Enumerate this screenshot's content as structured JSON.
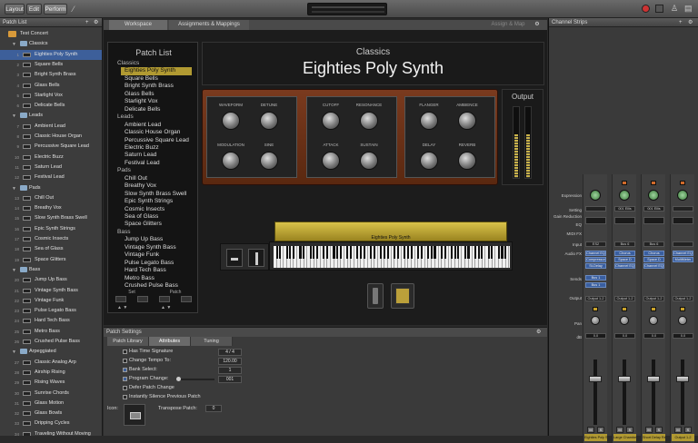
{
  "toolbar": {
    "layout": "Layout",
    "edit": "Edit",
    "perform": "Perform"
  },
  "patch_list_panel": {
    "title": "Patch List",
    "rows": [
      {
        "kind": "concert",
        "label": "Test Concert"
      },
      {
        "kind": "group",
        "label": "Classics"
      },
      {
        "kind": "patch",
        "num": "1",
        "label": "Eighties Poly Synth",
        "selected": true
      },
      {
        "kind": "patch",
        "num": "2",
        "label": "Square Bells"
      },
      {
        "kind": "patch",
        "num": "3",
        "label": "Bright Synth Brass"
      },
      {
        "kind": "patch",
        "num": "4",
        "label": "Glass Bells"
      },
      {
        "kind": "patch",
        "num": "5",
        "label": "Starlight Vox"
      },
      {
        "kind": "patch",
        "num": "6",
        "label": "Delicate Bells"
      },
      {
        "kind": "group",
        "label": "Leads"
      },
      {
        "kind": "patch",
        "num": "7",
        "label": "Ambient Lead"
      },
      {
        "kind": "patch",
        "num": "8",
        "label": "Classic House Organ"
      },
      {
        "kind": "patch",
        "num": "9",
        "label": "Percussive Square Lead"
      },
      {
        "kind": "patch",
        "num": "10",
        "label": "Electric Buzz"
      },
      {
        "kind": "patch",
        "num": "11",
        "label": "Saturn Lead"
      },
      {
        "kind": "patch",
        "num": "12",
        "label": "Festival Lead"
      },
      {
        "kind": "group",
        "label": "Pads"
      },
      {
        "kind": "patch",
        "num": "13",
        "label": "Chill Out"
      },
      {
        "kind": "patch",
        "num": "14",
        "label": "Breathy Vox"
      },
      {
        "kind": "patch",
        "num": "15",
        "label": "Slow Synth Brass Swell"
      },
      {
        "kind": "patch",
        "num": "16",
        "label": "Epic Synth Strings"
      },
      {
        "kind": "patch",
        "num": "17",
        "label": "Cosmic Insects"
      },
      {
        "kind": "patch",
        "num": "18",
        "label": "Sea of Glass"
      },
      {
        "kind": "patch",
        "num": "19",
        "label": "Space Glitters"
      },
      {
        "kind": "group",
        "label": "Bass"
      },
      {
        "kind": "patch",
        "num": "20",
        "label": "Jump Up Bass"
      },
      {
        "kind": "patch",
        "num": "21",
        "label": "Vintage Synth Bass"
      },
      {
        "kind": "patch",
        "num": "22",
        "label": "Vintage Funk"
      },
      {
        "kind": "patch",
        "num": "23",
        "label": "Pulse Legato Bass"
      },
      {
        "kind": "patch",
        "num": "24",
        "label": "Hard Tech Bass"
      },
      {
        "kind": "patch",
        "num": "25",
        "label": "Metro Bass"
      },
      {
        "kind": "patch",
        "num": "26",
        "label": "Crushed Pulse Bass"
      },
      {
        "kind": "group",
        "label": "Arpeggiated"
      },
      {
        "kind": "patch",
        "num": "27",
        "label": "Classic Analog Arp"
      },
      {
        "kind": "patch",
        "num": "28",
        "label": "Airship Rising"
      },
      {
        "kind": "patch",
        "num": "29",
        "label": "Rising Waves"
      },
      {
        "kind": "patch",
        "num": "30",
        "label": "Sunrise Chords"
      },
      {
        "kind": "patch",
        "num": "31",
        "label": "Glass Motion"
      },
      {
        "kind": "patch",
        "num": "32",
        "label": "Glass Bowls"
      },
      {
        "kind": "patch",
        "num": "33",
        "label": "Dripping Cycles"
      },
      {
        "kind": "patch",
        "num": "34",
        "label": "Traveling Without Moving"
      }
    ]
  },
  "tabs": {
    "workspace": "Workspace",
    "assign": "Assignments & Mappings",
    "assign_map": "Assign & Map"
  },
  "workspace_list": {
    "title": "Patch List",
    "entries": [
      {
        "c": "Classics"
      },
      {
        "i": "Eighties Poly Synth",
        "s": true
      },
      {
        "i": "Square Bells"
      },
      {
        "i": "Bright Synth Brass"
      },
      {
        "i": "Glass Bells"
      },
      {
        "i": "Starlight Vox"
      },
      {
        "i": "Delicate Bells"
      },
      {
        "c": "Leads"
      },
      {
        "i": "Ambient Lead"
      },
      {
        "i": "Classic House Organ"
      },
      {
        "i": "Percussive Square Lead"
      },
      {
        "i": "Electric Buzz"
      },
      {
        "i": "Saturn Lead"
      },
      {
        "i": "Festival Lead"
      },
      {
        "c": "Pads"
      },
      {
        "i": "Chill Out"
      },
      {
        "i": "Breathy Vox"
      },
      {
        "i": "Slow Synth Brass Swell"
      },
      {
        "i": "Epic Synth Strings"
      },
      {
        "i": "Cosmic Insects"
      },
      {
        "i": "Sea of Glass"
      },
      {
        "i": "Space Glitters"
      },
      {
        "c": "Bass"
      },
      {
        "i": "Jump Up Bass"
      },
      {
        "i": "Vintage Synth Bass"
      },
      {
        "i": "Vintage Funk"
      },
      {
        "i": "Pulse Legato Bass"
      },
      {
        "i": "Hard Tech Bass"
      },
      {
        "i": "Metro Bass"
      },
      {
        "i": "Crushed Pulse Bass"
      }
    ],
    "set_label": "Set",
    "patch_label": "Patch"
  },
  "header": {
    "category": "Classics",
    "patch": "Eighties Poly Synth"
  },
  "synth": {
    "panel1": {
      "waveform": "WAVEFORM",
      "detune": "DETUNE",
      "modulation": "MODULATION",
      "sine": "SINE"
    },
    "panel2": {
      "cutoff": "CUTOFF",
      "resonance": "RESONANCE",
      "attack": "ATTACK",
      "sustain": "SUSTAIN"
    },
    "panel3": {
      "flanger": "FLANGER",
      "ambience": "AMBIENCE",
      "delay": "DELAY",
      "reverb": "REVERB"
    }
  },
  "output": {
    "title": "Output"
  },
  "keyboard": {
    "name": "Eighties Poly Synth"
  },
  "settings": {
    "title": "Patch Settings",
    "tab_library": "Patch Library",
    "tab_attributes": "Attributes",
    "tab_tuning": "Tuning",
    "has_time_sig": "Has Time Signature",
    "time_sig_value": "4 / 4",
    "change_tempo": "Change Tempo To:",
    "tempo_value": "120.00",
    "bank_select": "Bank Select:",
    "bank_value": "1",
    "program_change": "Program Change:",
    "program_value": "001",
    "defer": "Defer Patch Change",
    "instantly_silence": "Instantly Silence Previous Patch",
    "icon_label": "Icon:",
    "transpose_label": "Transpose Patch:",
    "transpose_value": "0"
  },
  "channel_strips": {
    "title": "Channel Strips",
    "row_labels": {
      "expression": "Expression",
      "setting": "Setting",
      "gain_reduction": "Gain Reduction",
      "eq": "EQ",
      "midi_fx": "MIDI FX",
      "input": "Input",
      "audio_fx": "Audio FX",
      "sends": "Sends",
      "output": "Output",
      "pan": "Pan",
      "db": "dB"
    },
    "strips": [
      {
        "setting": "",
        "input": "ES2",
        "fx": [
          "Channel EQ",
          "Compressor",
          "St-Delay"
        ],
        "sends": [
          "Bus 1",
          "Bus 1"
        ],
        "output": "Output 1-2",
        "db": "0.0",
        "name": "Eighties Poly Syn"
      },
      {
        "setting": "001 Ellis",
        "input": "Bus 6",
        "fx": [
          "Chorus",
          "Space D",
          "Channel EQ"
        ],
        "sends": [],
        "output": "Output 1-2",
        "db": "0.0",
        "name": "Large Chamber"
      },
      {
        "setting": "001 Ellis",
        "input": "Bus 6",
        "fx": [
          "Chorus",
          "Space D",
          "Channel EQ"
        ],
        "sends": [],
        "output": "Output 1-2",
        "db": "0.0",
        "name": "Short Delay Reverb"
      },
      {
        "setting": "",
        "input": "",
        "fx": [
          "Channel EQ",
          "MultiMeter"
        ],
        "sends": [],
        "output": "Output 1-2",
        "db": "0.0",
        "name": "Output 1-2"
      }
    ]
  }
}
